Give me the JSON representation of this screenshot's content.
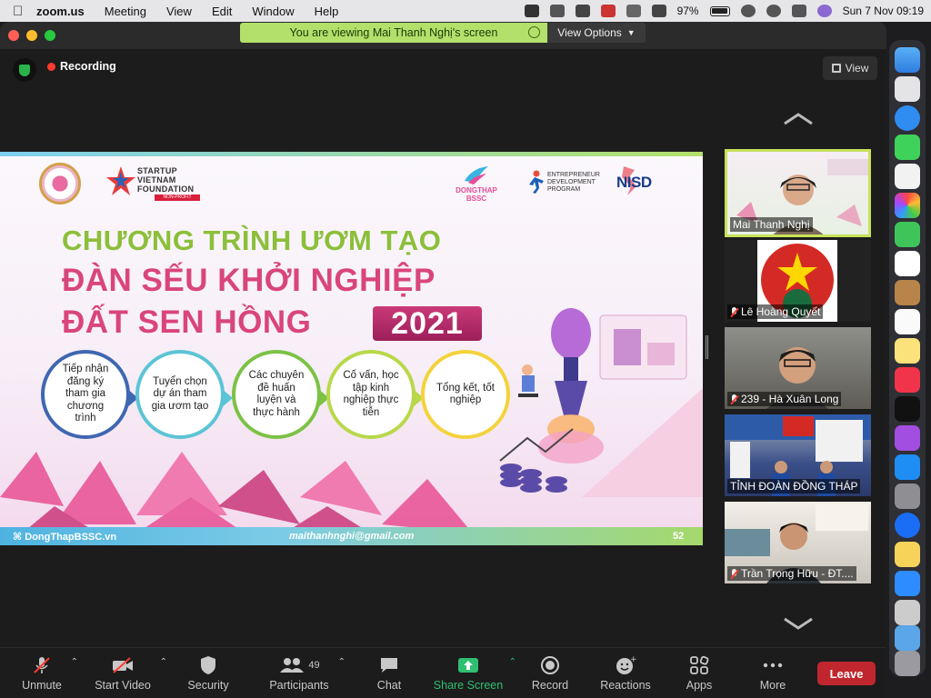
{
  "menubar": {
    "app_name": "zoom.us",
    "items": [
      "Meeting",
      "View",
      "Edit",
      "Window",
      "Help"
    ],
    "battery": "97%",
    "datetime": "Sun 7 Nov  09:19"
  },
  "banner": {
    "viewing_text": "You are viewing Mai Thanh Nghị's screen",
    "view_options": "View Options"
  },
  "header": {
    "recording": "Recording",
    "view_label": "View"
  },
  "slide": {
    "title_line1": "CHƯƠNG TRÌNH ƯƠM TẠO",
    "title_line2": "ĐÀN SẾU KHỞI NGHIỆP",
    "title_line3": "ĐẤT SEN HỒNG",
    "year": "2021",
    "logo_svf_text": "STARTUP\nVIETNAM\nFOUNDATION",
    "logo_svf_tag": "NON-PROFIT",
    "logo_bssc": "DONGTHAP\nBSSC",
    "logo_edp": "ENTREPRENEUR\nDEVELOPMENT\nPROGRAM",
    "logo_nisd": "NISD",
    "steps": [
      "Tiếp nhận đăng ký tham gia chương trình",
      "Tuyển chọn dự án tham gia ươm tạo",
      "Các chuyên đề huấn luyện và thực hành",
      "Cố vấn, học tập kinh nghiệp thực tiễn",
      "Tổng kết, tốt nghiệp"
    ],
    "footer_site": "⌘ DongThapBSSC.vn",
    "footer_email": "maithanhnghi@gmail.com",
    "footer_page": "52"
  },
  "participants": [
    {
      "name": "Mai Thanh Nghị",
      "muted": false,
      "active": true
    },
    {
      "name": "Lê Hoàng Quyết",
      "muted": true,
      "active": false
    },
    {
      "name": "239 - Hà Xuân Long",
      "muted": true,
      "active": false
    },
    {
      "name": "TỈNH ĐOÀN ĐỒNG THÁP",
      "muted": false,
      "active": false
    },
    {
      "name": "Trần Trọng Hữu - ĐT....",
      "muted": true,
      "active": false
    }
  ],
  "toolbar": {
    "unmute": "Unmute",
    "start_video": "Start Video",
    "security": "Security",
    "participants": "Participants",
    "participants_count": "49",
    "chat": "Chat",
    "share_screen": "Share Screen",
    "record": "Record",
    "reactions": "Reactions",
    "apps": "Apps",
    "more": "More",
    "leave": "Leave"
  },
  "colors": {
    "accent_green": "#b3e06b",
    "share_green": "#2fbf71",
    "leave_red": "#c0262d",
    "title_pink": "#d9457a",
    "title_green": "#8cbf3a"
  }
}
